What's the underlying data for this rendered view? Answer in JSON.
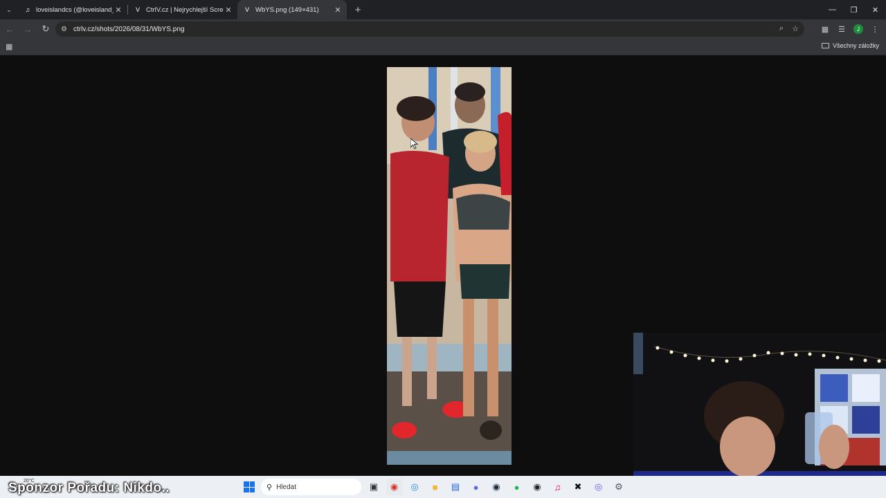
{
  "tabs": [
    {
      "title": "loveislandcs (@loveisland_czsk)",
      "icon": "tiktok-icon",
      "active": false
    },
    {
      "title": "CtrlV.cz | Nejrychlejší ScreenShot",
      "icon": "ctrlv-icon",
      "active": false
    },
    {
      "title": "WbYS.png (149×431)",
      "icon": "ctrlv-icon",
      "active": true
    }
  ],
  "address": {
    "url": "ctrlv.cz/shots/2026/08/31/WbYS.png"
  },
  "profile": {
    "initial": "J"
  },
  "bookmarks": {
    "all_label": "Všechny záložky"
  },
  "taskbar": {
    "weather_temp": "20°C",
    "search_placeholder": "Hledat",
    "apps": [
      "file-explorer-icon",
      "chrome-icon",
      "edge-icon",
      "folder-icon",
      "notes-icon",
      "discord-icon",
      "steam-icon",
      "spotify-icon",
      "obs-icon",
      "tiktok-icon",
      "capcut-icon",
      "messenger-icon",
      "settings-icon"
    ]
  },
  "overlay": {
    "sponsor_text": "Sponzor Pořadu: Nikdo.."
  },
  "colors": {
    "accent": "#1a73e8",
    "tab_bg": "#202124",
    "toolbar_bg": "#35363a",
    "viewer_bg": "#0e0e0e"
  }
}
